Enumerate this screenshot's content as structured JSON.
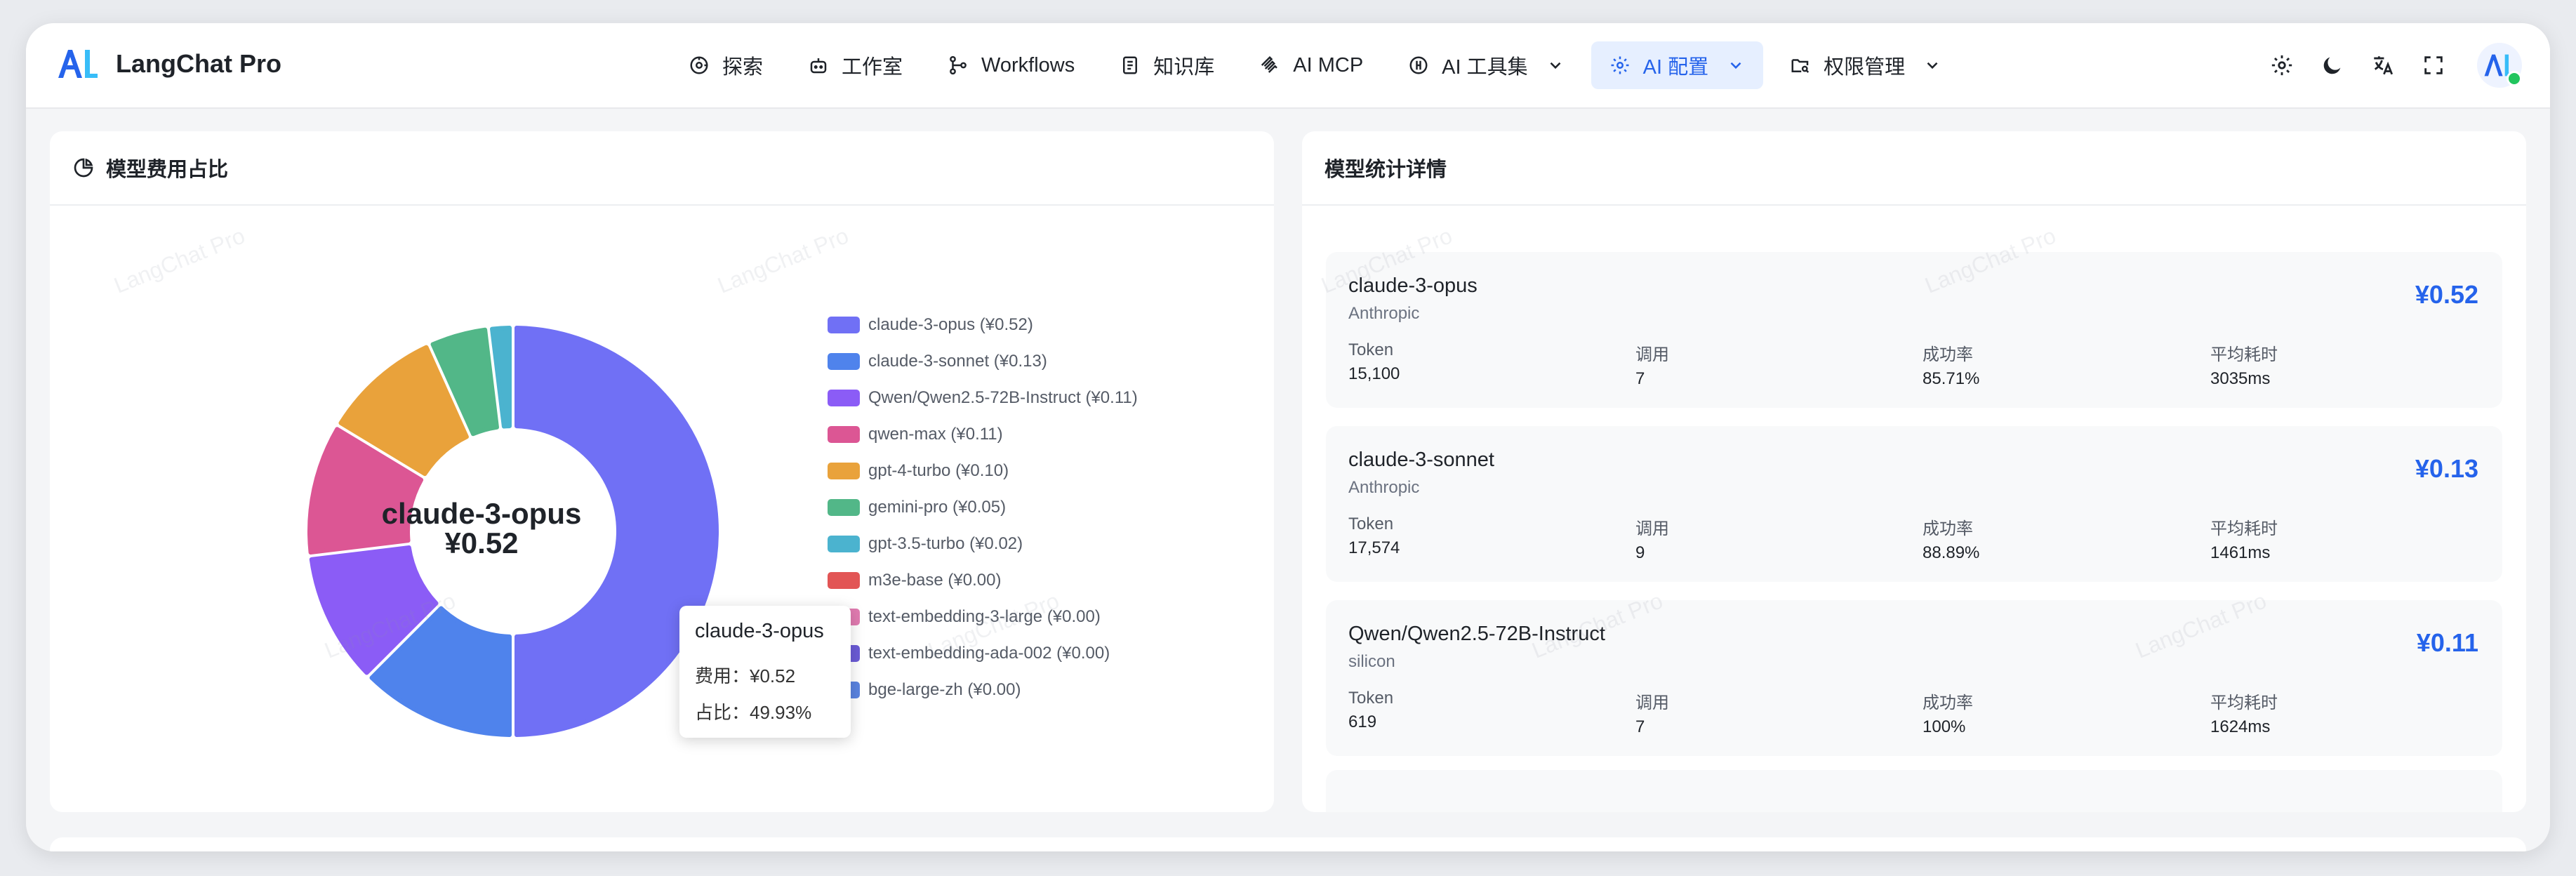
{
  "brand": {
    "name": "LangChat Pro"
  },
  "nav": {
    "items": [
      {
        "label": "探索",
        "icon": "compass-icon"
      },
      {
        "label": "工作室",
        "icon": "robot-icon"
      },
      {
        "label": "Workflows",
        "icon": "workflow-icon"
      },
      {
        "label": "知识库",
        "icon": "book-icon"
      },
      {
        "label": "AI MCP",
        "icon": "mcp-icon"
      },
      {
        "label": "AI 工具集",
        "icon": "toolbox-icon",
        "dropdown": true
      },
      {
        "label": "AI 配置",
        "icon": "gear-icon",
        "dropdown": true,
        "active": true
      },
      {
        "label": "权限管理",
        "icon": "folder-key-icon",
        "dropdown": true
      }
    ]
  },
  "toolbar": {
    "icons": [
      "settings-icon",
      "dark-mode-icon",
      "translate-icon",
      "fullscreen-icon"
    ]
  },
  "pie_card": {
    "title": "模型费用占比",
    "center_name": "claude-3-opus",
    "center_value": "¥0.52"
  },
  "tooltip": {
    "title": "claude-3-opus",
    "cost_label": "费用：",
    "cost_value": "¥0.52",
    "ratio_label": "占比：",
    "ratio_value": "49.93%"
  },
  "chart_data": {
    "type": "pie",
    "donut": true,
    "legend_position": "right",
    "categories": [
      "claude-3-opus",
      "claude-3-sonnet",
      "Qwen/Qwen2.5-72B-Instruct",
      "qwen-max",
      "gpt-4-turbo",
      "gemini-pro",
      "gpt-3.5-turbo",
      "m3e-base",
      "text-embedding-3-large",
      "text-embedding-ada-002",
      "bge-large-zh"
    ],
    "values": [
      0.52,
      0.13,
      0.11,
      0.11,
      0.1,
      0.05,
      0.02,
      0.0,
      0.0,
      0.0,
      0.0
    ],
    "legend_labels": [
      "claude-3-opus (¥0.52)",
      "claude-3-sonnet (¥0.13)",
      "Qwen/Qwen2.5-72B-Instruct (¥0.11)",
      "qwen-max (¥0.11)",
      "gpt-4-turbo (¥0.10)",
      "gemini-pro (¥0.05)",
      "gpt-3.5-turbo (¥0.02)",
      "m3e-base (¥0.00)",
      "text-embedding-3-large (¥0.00)",
      "text-embedding-ada-002 (¥0.00)",
      "bge-large-zh (¥0.00)"
    ],
    "colors": [
      "#7070f5",
      "#4f83ec",
      "#8b5cf6",
      "#dc5694",
      "#e9a23b",
      "#52b788",
      "#4bb3cf",
      "#e25555",
      "#e07bb0",
      "#6b5bd6",
      "#5b84e0"
    ]
  },
  "stats_card": {
    "title": "模型统计详情",
    "labels": {
      "token": "Token",
      "calls": "调用",
      "success": "成功率",
      "latency": "平均耗时"
    },
    "items": [
      {
        "name": "claude-3-opus",
        "provider": "Anthropic",
        "cost": "¥0.52",
        "token": "15,100",
        "calls": "7",
        "success": "85.71%",
        "latency": "3035ms"
      },
      {
        "name": "claude-3-sonnet",
        "provider": "Anthropic",
        "cost": "¥0.13",
        "token": "17,574",
        "calls": "9",
        "success": "88.89%",
        "latency": "1461ms"
      },
      {
        "name": "Qwen/Qwen2.5-72B-Instruct",
        "provider": "silicon",
        "cost": "¥0.11",
        "token": "619",
        "calls": "7",
        "success": "100%",
        "latency": "1624ms"
      }
    ]
  },
  "watermark": {
    "text": "LangChat Pro"
  }
}
